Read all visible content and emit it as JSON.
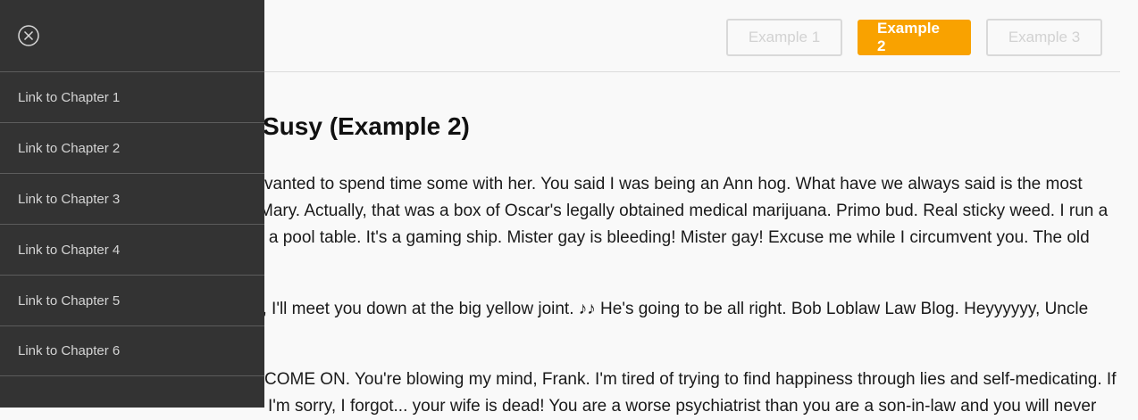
{
  "header": {
    "tabs": [
      {
        "label": "Example 1",
        "active": false
      },
      {
        "label": "Example 2",
        "active": true
      },
      {
        "label": "Example 3",
        "active": false
      }
    ]
  },
  "article": {
    "title_visible": "Susy (Example 2)",
    "lines": [
      "vanted to spend time some with her. You said I was being an Ann hog. What have we always said is the most",
      "Mary. Actually, that was a box of Oscar's legally obtained medical marijuana. Primo bud. Real sticky weed. I run a",
      "h a pool table. It's a gaming ship. Mister gay is bleeding! Mister gay! Excuse me while I circumvent you. The old",
      "it, I'll meet you down at the big yellow joint. ♪♪ He's going to be all right. Bob Loblaw Law Blog. Heyyyyyy, Uncle",
      "COME ON. You're blowing my mind, Frank. I'm tired of trying to find happiness through lies and self-medicating. If",
      "I'm sorry, I forgot... your wife is dead! You are a worse psychiatrist than you are a son-in-law and you will never"
    ]
  },
  "sidebar": {
    "close_icon": "close-circle-icon",
    "items": [
      {
        "label": "Link to Chapter 1"
      },
      {
        "label": "Link to Chapter 2"
      },
      {
        "label": "Link to Chapter 3"
      },
      {
        "label": "Link to Chapter 4"
      },
      {
        "label": "Link to Chapter 5"
      },
      {
        "label": "Link to Chapter 6"
      }
    ]
  },
  "colors": {
    "accent": "#f9a200",
    "sidebar_bg": "#333333",
    "page_bg": "#f9f9f9"
  }
}
